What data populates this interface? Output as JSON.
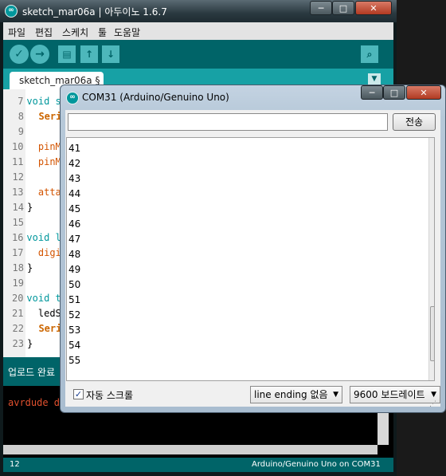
{
  "ide": {
    "title": "sketch_mar06a | 아두이노 1.6.7",
    "menu": [
      "파일",
      "편집",
      "스케치",
      "툴",
      "도움말"
    ],
    "tab_label": "sketch_mar06a §",
    "code_lines": [
      {
        "num": "7",
        "text": "void se"
      },
      {
        "num": "8",
        "text": "  Seri"
      },
      {
        "num": "9",
        "text": ""
      },
      {
        "num": "10",
        "text": "  pinMo"
      },
      {
        "num": "11",
        "text": "  pinMo"
      },
      {
        "num": "12",
        "text": ""
      },
      {
        "num": "13",
        "text": "  attac"
      },
      {
        "num": "14",
        "text": "}"
      },
      {
        "num": "15",
        "text": ""
      },
      {
        "num": "16",
        "text": "void le"
      },
      {
        "num": "17",
        "text": "  digit"
      },
      {
        "num": "18",
        "text": "}"
      },
      {
        "num": "19",
        "text": ""
      },
      {
        "num": "20",
        "text": "void to"
      },
      {
        "num": "21",
        "text": "  ledSt"
      },
      {
        "num": "22",
        "text": "  Seri"
      },
      {
        "num": "23",
        "text": "}"
      }
    ],
    "status": "업로드 완료",
    "console": "avrdude dor",
    "line_number": "12",
    "board": "Arduino/Genuino Uno on COM31"
  },
  "serial": {
    "title": "COM31 (Arduino/Genuino Uno)",
    "send_label": "전송",
    "input_value": "",
    "output_lines": [
      "41",
      "42",
      "43",
      "44",
      "45",
      "46",
      "47",
      "48",
      "49",
      "50",
      "51",
      "52",
      "53",
      "54",
      "55"
    ],
    "autoscroll_label": "자동 스크롤",
    "autoscroll_checked": true,
    "line_ending": "line ending 없음",
    "baud": "9600 보드레이트"
  },
  "colors": {
    "teal_dark": "#006468",
    "teal_tab": "#17a1a5",
    "console_error": "#e0502e"
  }
}
